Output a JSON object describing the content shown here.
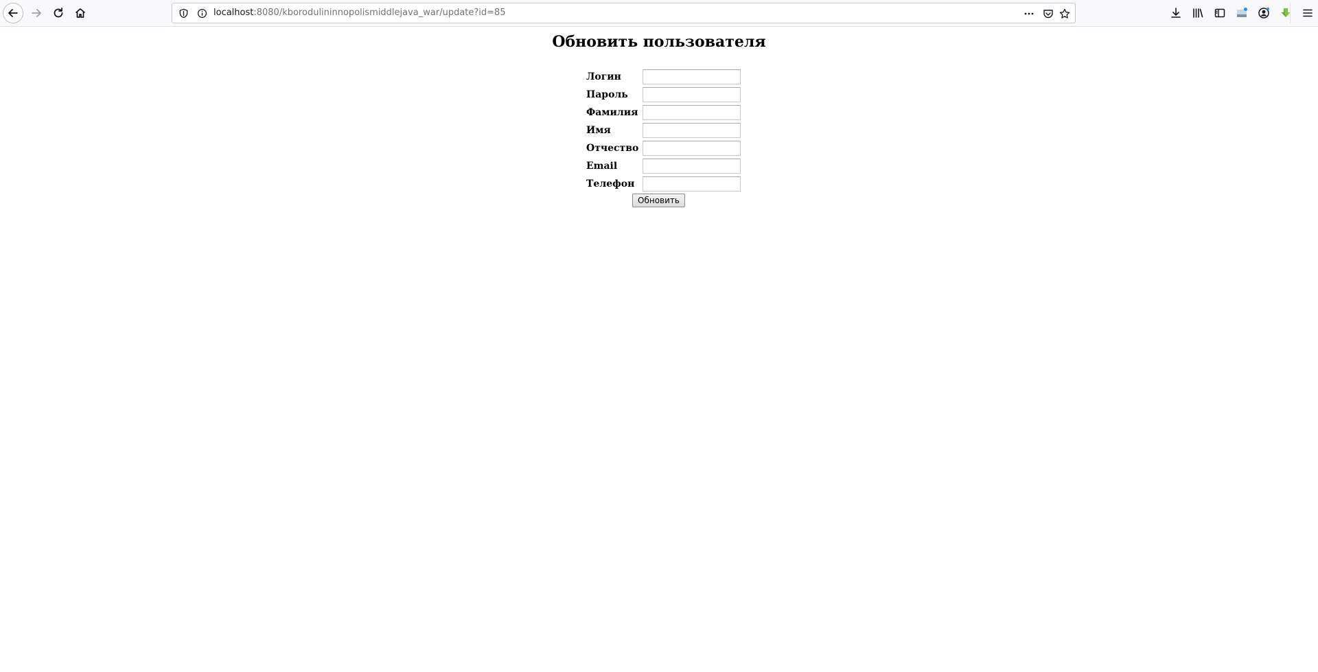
{
  "browser": {
    "url_host": "localhost",
    "url_path": ":8080/kborodulininnopolismiddlejava_war/update?id=85",
    "icons": {
      "back": "back-arrow-icon",
      "forward": "forward-arrow-icon",
      "reload": "reload-icon",
      "home": "home-icon",
      "shield": "shield-icon",
      "info": "info-icon",
      "more": "more-dots-icon",
      "pocket": "pocket-icon",
      "bookmark": "star-icon",
      "download": "download-icon",
      "library": "library-icon",
      "sidebar": "sidebar-icon",
      "extension": "extension-icon",
      "account": "account-icon",
      "download_extension": "green-download-icon",
      "menu": "hamburger-menu-icon"
    }
  },
  "page": {
    "title": "Обновить пользователя",
    "fields": [
      {
        "label": "Логин",
        "value": ""
      },
      {
        "label": "Пароль",
        "value": ""
      },
      {
        "label": "Фамилия",
        "value": ""
      },
      {
        "label": "Имя",
        "value": ""
      },
      {
        "label": "Отчество",
        "value": ""
      },
      {
        "label": "Email",
        "value": ""
      },
      {
        "label": "Телефон",
        "value": ""
      }
    ],
    "submit_label": "Обновить"
  }
}
